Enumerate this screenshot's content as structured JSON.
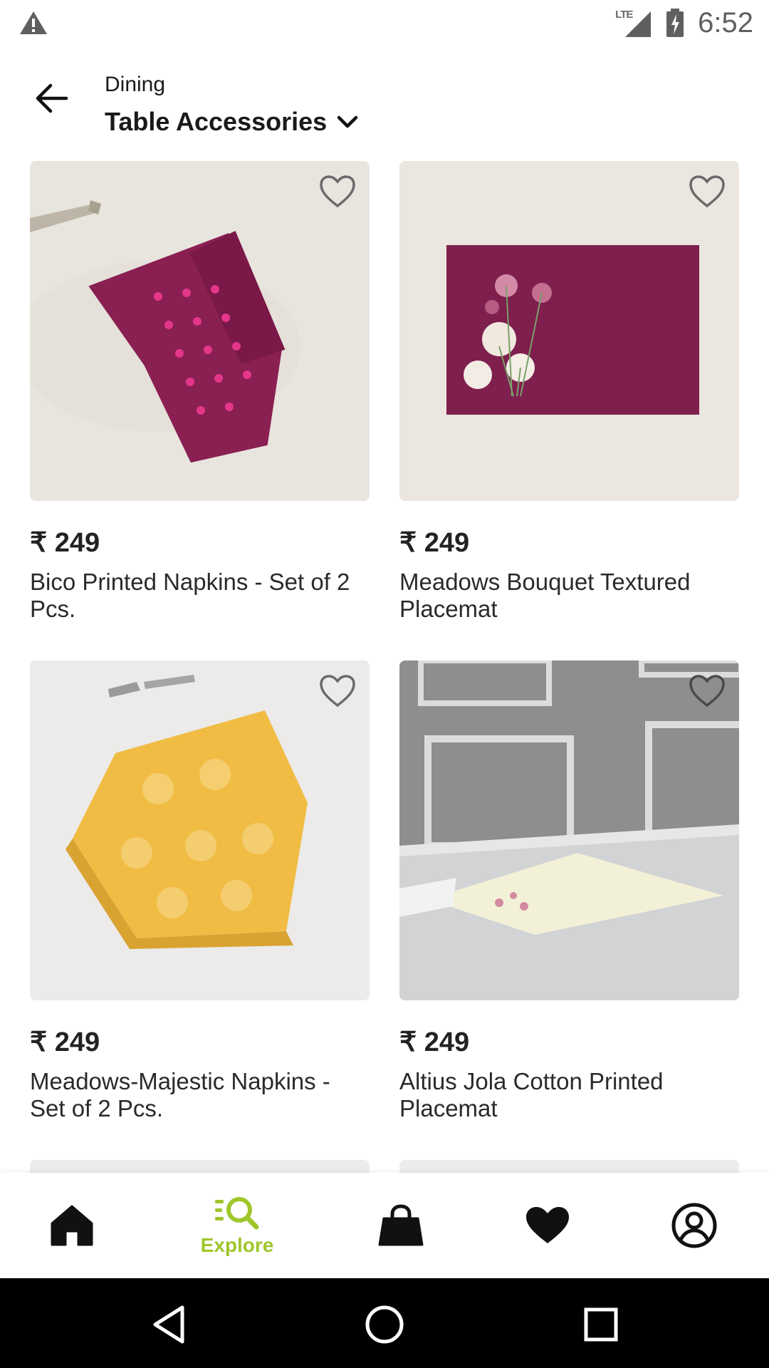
{
  "status_bar": {
    "time": "6:52",
    "network": "LTE"
  },
  "header": {
    "breadcrumb": "Dining",
    "title": "Table Accessories"
  },
  "products": [
    {
      "price": "₹ 249",
      "name": "Bico Printed Napkins - Set of 2 Pcs."
    },
    {
      "price": "₹ 249",
      "name": "Meadows Bouquet Textured Placemat"
    },
    {
      "price": "₹ 249",
      "name": "Meadows-Majestic Napkins - Set of 2 Pcs."
    },
    {
      "price": "₹ 249",
      "name": "Altius Jola Cotton Printed Placemat"
    }
  ],
  "bottom_nav": {
    "items": [
      {
        "icon": "home-icon",
        "label": ""
      },
      {
        "icon": "explore-icon",
        "label": "Explore",
        "active": true
      },
      {
        "icon": "bag-icon",
        "label": ""
      },
      {
        "icon": "heart-icon",
        "label": ""
      },
      {
        "icon": "profile-icon",
        "label": ""
      }
    ],
    "active_color": "#9fc62a"
  },
  "colors": {
    "accent": "#9fc62a",
    "text": "#1a1a1a"
  }
}
